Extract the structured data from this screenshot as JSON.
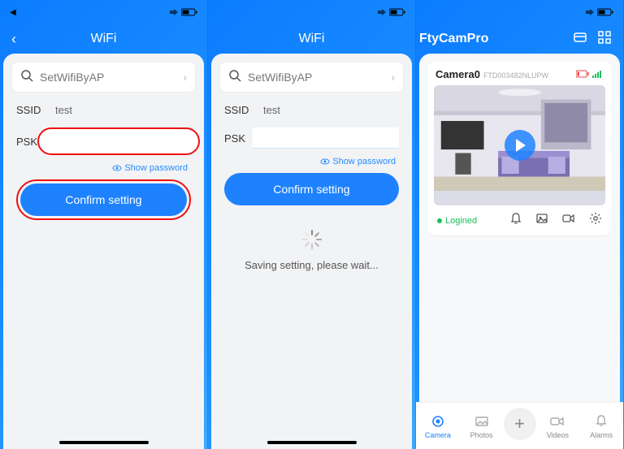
{
  "screens": {
    "s1": {
      "title": "WiFi",
      "setwifi": "SetWifiByAP",
      "ssid_label": "SSID",
      "ssid_value": "test",
      "psk_label": "PSK",
      "show_pw": "Show password",
      "confirm": "Confirm setting"
    },
    "s2": {
      "title": "WiFi",
      "setwifi": "SetWifiByAP",
      "ssid_label": "SSID",
      "ssid_value": "test",
      "psk_label": "PSK",
      "show_pw": "Show password",
      "confirm": "Confirm setting",
      "saving": "Saving setting, please wait..."
    },
    "s3": {
      "title": "FtyCamPro",
      "camera_name": "Camera0",
      "camera_id": "FTD003482NLUPW",
      "status": "Logined",
      "tabs": {
        "camera": "Camera",
        "photos": "Photos",
        "videos": "Videos",
        "alarms": "Alarms"
      }
    }
  },
  "colors": {
    "accent": "#1e82ff",
    "highlight": "#e11",
    "success": "#1bbf5c"
  }
}
